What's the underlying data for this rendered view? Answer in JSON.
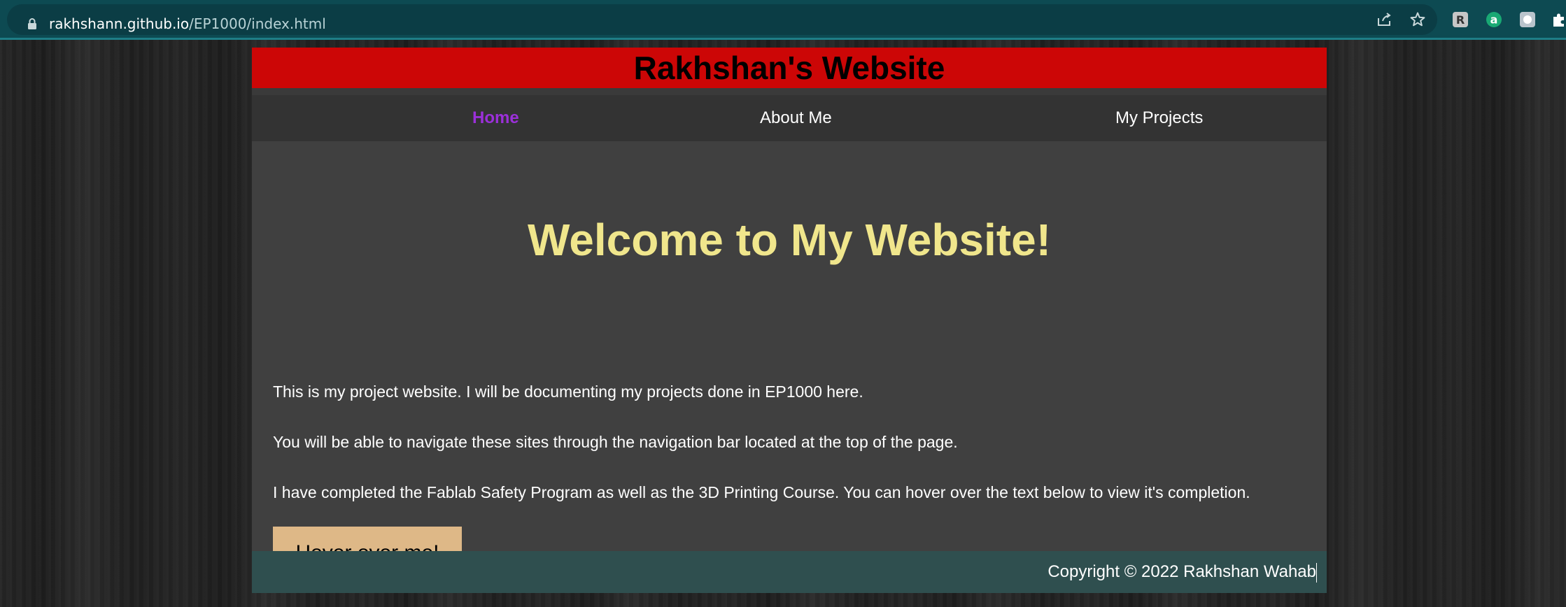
{
  "browser": {
    "url_host": "rakhshann.github.io",
    "url_path": "/EP1000/index.html",
    "icons": [
      "lock-icon",
      "share-icon",
      "star-icon",
      "extension-r-icon",
      "extension-a-icon",
      "extension-circle-icon",
      "puzzle-icon"
    ],
    "colors": {
      "toolbar": "#0d4a52",
      "accent": "#1e7d86"
    }
  },
  "header": {
    "title": "Rakhshan's Website",
    "background": "#cc0606"
  },
  "nav": {
    "items": [
      {
        "label": "Home",
        "active": true
      },
      {
        "label": "About Me",
        "active": false
      },
      {
        "label": "My Projects",
        "active": false
      }
    ],
    "active_color": "#9b30d9"
  },
  "main": {
    "heading": "Welcome to My Website!",
    "heading_color": "#f0e68c",
    "paragraphs": [
      "This is my project website. I will be documenting my projects done in EP1000 here.",
      "You will be able to navigate these sites through the navigation bar located at the top of the page.",
      "I have completed the Fablab Safety Program as well as the 3D Printing Course. You can hover over the text below to view it's completion."
    ],
    "button_label": "Hover over me!",
    "button_color": "#deb887"
  },
  "footer": {
    "copyright": "Copyright © 2022 Rakhshan Wahab",
    "background": "#2f4f4f"
  }
}
